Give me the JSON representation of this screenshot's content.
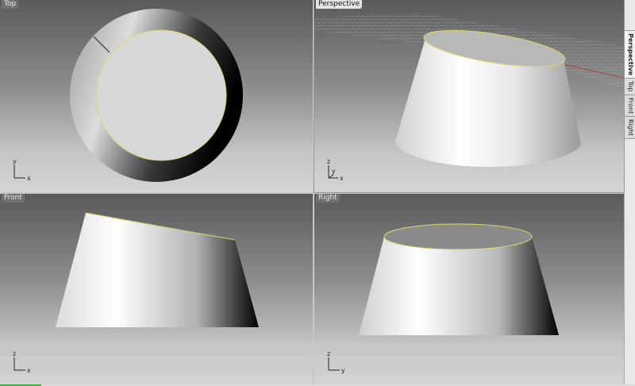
{
  "viewports": {
    "top": {
      "label": "Top",
      "axis_x": "x",
      "axis_y": "y"
    },
    "perspective": {
      "label": "Perspective",
      "axis_x": "x",
      "axis_y": "y",
      "axis_z": "z"
    },
    "front": {
      "label": "Front",
      "axis_x": "x",
      "axis_z": "z"
    },
    "right": {
      "label": "Right",
      "axis_y": "y",
      "axis_z": "z"
    }
  },
  "side_tabs": [
    {
      "label": "Perspective",
      "active": true
    },
    {
      "label": "Top",
      "active": false
    },
    {
      "label": "Front",
      "active": false
    },
    {
      "label": "Right",
      "active": false
    }
  ],
  "colors": {
    "edge_highlight": "#d8d86a",
    "surface_light": "#ffffff",
    "surface_dark": "#000000",
    "grid": "#b0b0b0",
    "axis_red": "#b04040",
    "status_green": "#3bb23b"
  }
}
